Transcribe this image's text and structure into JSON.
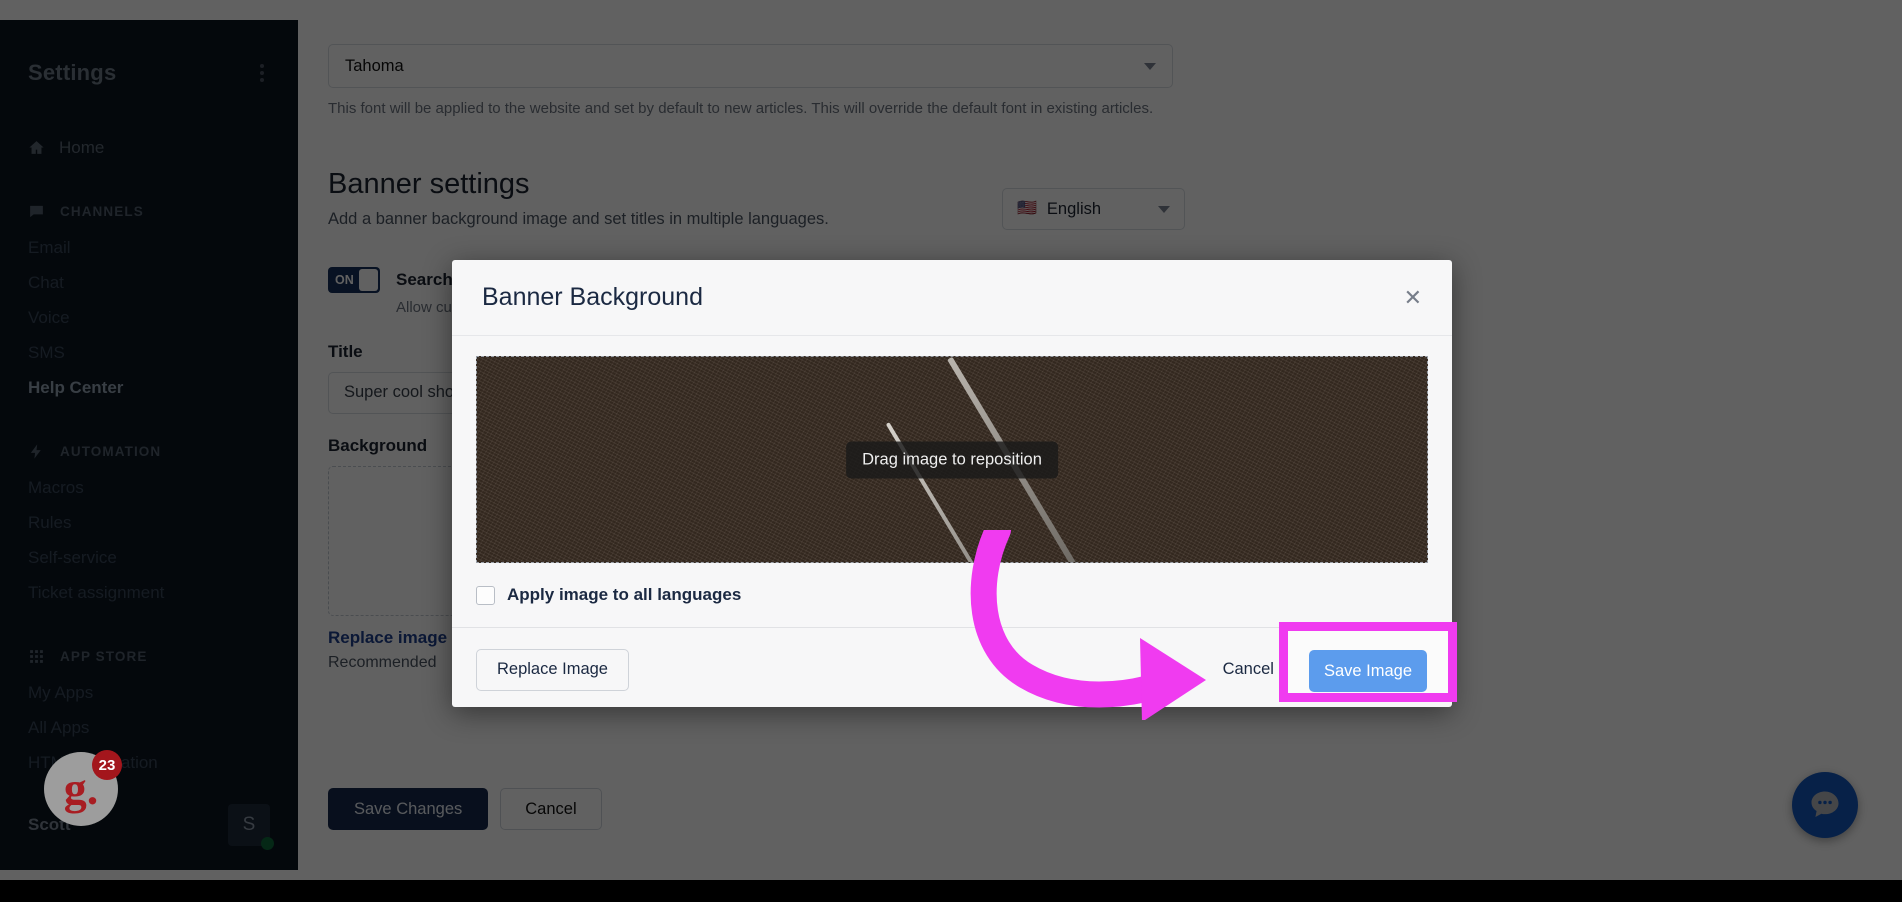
{
  "sidebar": {
    "title": "Settings",
    "menu_icon": "kebab-menu-icon",
    "home": {
      "label": "Home",
      "icon": "home-icon"
    },
    "groups": [
      {
        "label": "CHANNELS",
        "icon": "chat-bubble-icon",
        "items": [
          {
            "label": "Email",
            "active": false
          },
          {
            "label": "Chat",
            "active": false
          },
          {
            "label": "Voice",
            "active": false
          },
          {
            "label": "SMS",
            "active": false
          },
          {
            "label": "Help Center",
            "active": true
          }
        ]
      },
      {
        "label": "AUTOMATION",
        "icon": "lightning-bolt-icon",
        "items": [
          {
            "label": "Macros",
            "active": false
          },
          {
            "label": "Rules",
            "active": false
          },
          {
            "label": "Self-service",
            "active": false
          },
          {
            "label": "Ticket assignment",
            "active": false
          }
        ]
      },
      {
        "label": "APP STORE",
        "icon": "grid-icon",
        "items": [
          {
            "label": "My Apps",
            "active": false
          },
          {
            "label": "All Apps",
            "active": false
          },
          {
            "label": "HTML integration",
            "active": false
          }
        ]
      }
    ],
    "user": {
      "name": "Scott",
      "avatar_initial": "S",
      "presence": "online"
    }
  },
  "main": {
    "font_select": {
      "value": "Tahoma",
      "icon": "chevron-down-icon"
    },
    "font_helper": "This font will be applied to the website and set by default to new articles. This will override the default font in existing articles.",
    "banner": {
      "title": "Banner settings",
      "subtitle": "Add a banner background image and set titles in multiple languages.",
      "language": {
        "flag": "🇺🇸",
        "label": "English",
        "icon": "chevron-down-icon"
      }
    },
    "search_toggle": {
      "state": "ON",
      "label": "Search",
      "help": "Allow cus"
    },
    "title_field": {
      "label": "Title",
      "value": "Super cool sho"
    },
    "background_field": {
      "label": "Background",
      "replace_link": "Replace image",
      "recommended": "Recommended"
    },
    "actions": {
      "save": "Save Changes",
      "cancel": "Cancel"
    },
    "chat_fab_icon": "chat-bubble-icon"
  },
  "modal": {
    "title": "Banner Background",
    "close_icon": "close-icon",
    "drag_tip": "Drag image to reposition",
    "apply_all": {
      "label": "Apply image to all languages",
      "checked": false
    },
    "replace_button": "Replace Image",
    "cancel_button": "Cancel",
    "save_button": "Save Image"
  },
  "annotation": {
    "highlight_color": "#f03bf0",
    "arrow_color": "#f03bf0",
    "target": "Save Image"
  },
  "help_widget": {
    "logo_text": "g.",
    "badge_count": "23"
  },
  "colors": {
    "sidebar_bg": "#0d1621",
    "primary_button": "#16294d",
    "save_image_button": "#5c9ced",
    "link": "#1f3f8f",
    "highlight": "#f03bf0"
  }
}
